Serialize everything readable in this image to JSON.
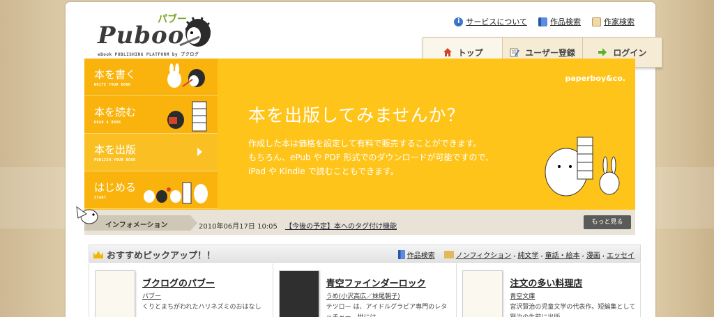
{
  "logo": {
    "name": "Puboo",
    "kana": "パブー",
    "tagline": "eBook PUBLISHING PLATFORM by ブクログ"
  },
  "toplinks": [
    {
      "label": "サービスについて",
      "icon": "info-icon"
    },
    {
      "label": "作品検索",
      "icon": "book-icon"
    },
    {
      "label": "作家検索",
      "icon": "author-face-icon"
    }
  ],
  "navtabs": [
    {
      "label": "トップ",
      "icon": "home-icon"
    },
    {
      "label": "ユーザー登録",
      "icon": "register-icon"
    },
    {
      "label": "ログイン",
      "icon": "login-arrow-icon"
    }
  ],
  "sidenav": [
    {
      "label": "本を書く",
      "en": "WRITE YOUR BOOK"
    },
    {
      "label": "本を読む",
      "en": "READ A BOOK"
    },
    {
      "label": "本を出版",
      "en": "PUBLISH YOUR BOOK"
    },
    {
      "label": "はじめる",
      "en": "START"
    }
  ],
  "hero": {
    "brand": "paperboy&co.",
    "title": "本を出版してみませんか？",
    "desc1": "作成した本は価格を設定して有料で販売することができます。",
    "desc2": "もちろん、ePub や PDF 形式でのダウンロードが可能ですので、",
    "desc3": "iPad や Kindle で読むこともできます。"
  },
  "info": {
    "label": "インフォメーション",
    "date": "2010年06月17日 10:05",
    "link": "【今後の予定】本へのタグ付け機能",
    "more": "もっと見る"
  },
  "pickup": {
    "title": "おすすめピックアップ！！",
    "search": "作品検索",
    "categories": [
      "ノンフィクション",
      "純文学",
      "童話・絵本",
      "漫画",
      "エッセイ"
    ]
  },
  "books": [
    {
      "title": "ブクログのパブー",
      "author": "パブー",
      "desc": "くりとまちがわれたハリネズミのおはなし"
    },
    {
      "title": "青空ファインダーロック",
      "author": "うめ(小沢高広／妹尾朝子)",
      "desc": "テツロー は、アイドルグラビア専門のレタッチャー。世には…"
    },
    {
      "title": "注文の多い料理店",
      "author": "青空文庫",
      "desc": "宮沢賢治の児童文学の代表作。短編集として賢治の生前に出版…"
    }
  ],
  "colors": {
    "hero": "#ffc41a",
    "sidenav": "#f9b30c",
    "accent": "#7aa51c"
  }
}
